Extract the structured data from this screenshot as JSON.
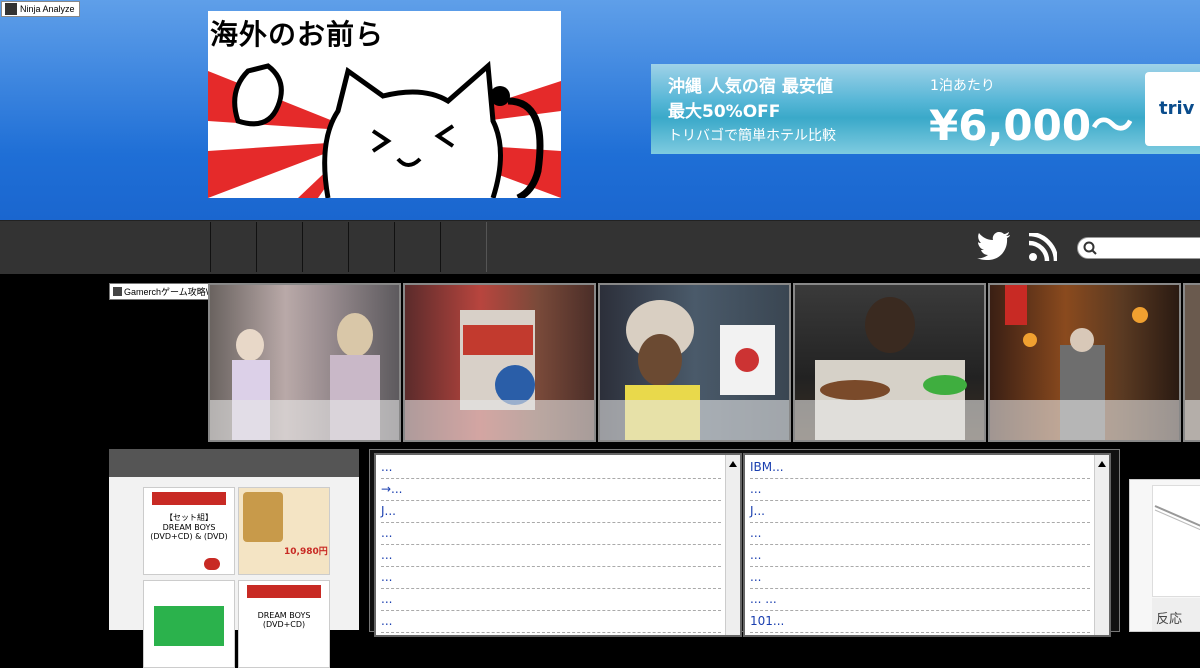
{
  "ninja": {
    "label": "Ninja Analyze"
  },
  "logo": {
    "title": "海外のお前ら"
  },
  "ad": {
    "line1": "沖縄 人気の宿 最安値",
    "line2": "最大50%OFF",
    "line3": "トリバゴで簡単ホテル比較",
    "per_night": "1泊あたり",
    "price": "¥6,000～",
    "brand": "triv"
  },
  "gamerch": {
    "label": "Gamerchゲーム攻略Wiki"
  },
  "products": [
    {
      "text": "【セット組】 DREAM BOYS (DVD+CD) & (DVD)"
    },
    {
      "text": "10,980円"
    },
    {
      "text": ""
    },
    {
      "text": "DREAM BOYS (DVD+CD)"
    }
  ],
  "list_left": [
    "...",
    "→...",
    "J...",
    " ...",
    " ...",
    " ...",
    "...",
    "..."
  ],
  "list_right": [
    "IBM...",
    "...",
    "J...",
    " ...",
    " ...",
    " ...",
    "... ...",
    "101..."
  ],
  "rightbox": {
    "text": "反応"
  },
  "colors": {
    "header_top": "#5f9fe9",
    "header_bottom": "#1a66cf",
    "nav": "#333333",
    "link": "#1a3faf"
  }
}
